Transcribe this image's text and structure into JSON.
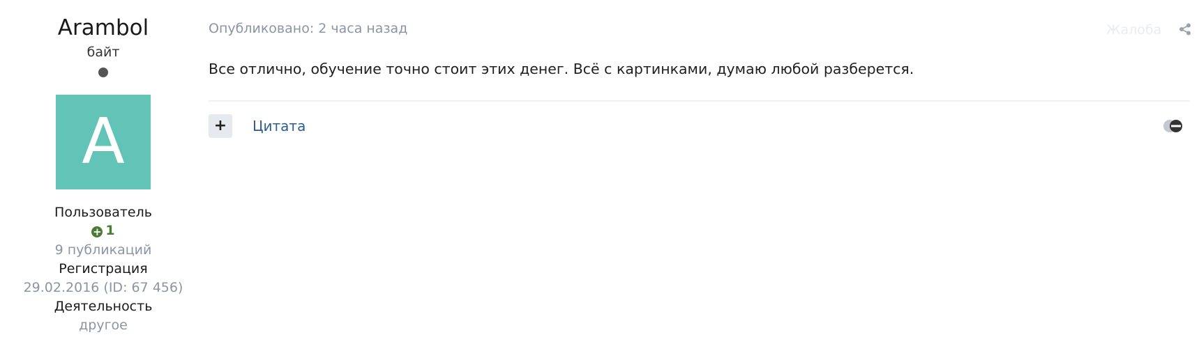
{
  "author": {
    "name": "Arambol",
    "title": "байт",
    "avatar_letter": "A",
    "avatar_color": "#62c4b6",
    "group": "Пользователь",
    "reputation": "1",
    "reputation_color": "#4c7a34",
    "posts_count": "9 публикаций",
    "registration_label": "Регистрация",
    "registration_value": "29.02.2016 (ID: 67 456)",
    "activity_label": "Деятельность",
    "activity_value": "другое"
  },
  "post": {
    "date": "Опубликовано: 2 часа назад",
    "report_label": "Жалоба",
    "text": "Все отлично, обучение точно стоит этих денег. Всё с картинками, думаю любой разберется.",
    "multiquote_label": "+",
    "quote_label": "Цитата"
  },
  "icons": {
    "status": "online-status-dot",
    "reputation": "plus-circle-icon",
    "share": "share-icon",
    "ignore": "ignore-user-icon"
  },
  "colors": {
    "link": "#2a5d91",
    "muted": "#8a95a5"
  }
}
